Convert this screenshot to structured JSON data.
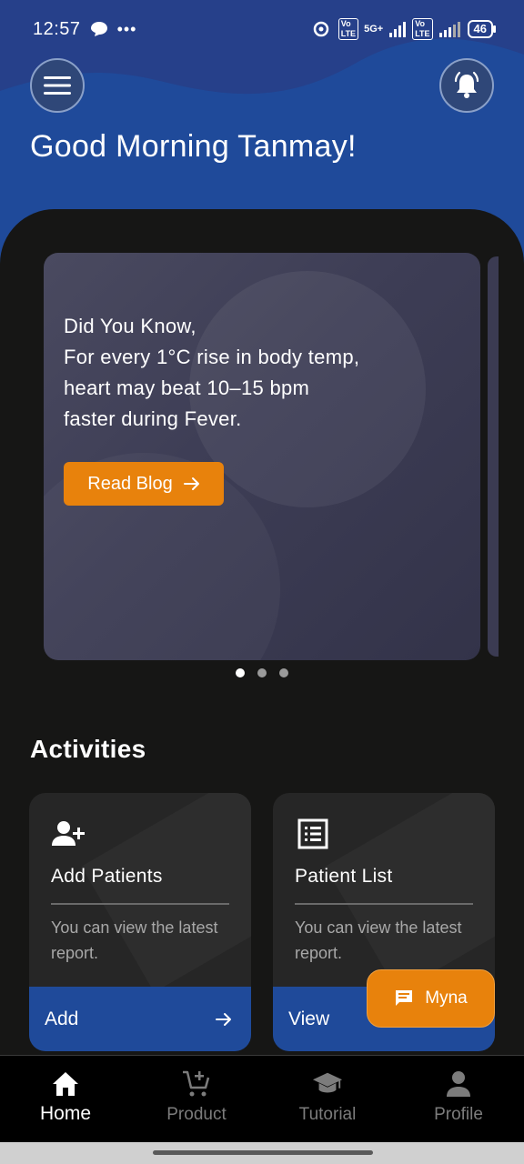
{
  "status_bar": {
    "time": "12:57",
    "network": "5G+",
    "lte_badge": "Vo LTE",
    "battery": "46"
  },
  "header": {
    "greeting": "Good Morning Tanmay!"
  },
  "carousel": {
    "lines": [
      "Did You Know,",
      "For every 1°C rise in body temp,",
      "heart may beat 10–15 bpm",
      "faster during Fever."
    ],
    "button_label": "Read Blog",
    "active_index": 0,
    "total": 3
  },
  "activities": {
    "title": "Activities",
    "cards": [
      {
        "title": "Add Patients",
        "description": "You can view the latest report.",
        "action": "Add"
      },
      {
        "title": "Patient List",
        "description": "You can view the latest report.",
        "action": "View"
      }
    ]
  },
  "chat_fab": {
    "label": "Myna"
  },
  "bottom_nav": {
    "items": [
      {
        "label": "Home",
        "icon": "home-icon",
        "active": true
      },
      {
        "label": "Product",
        "icon": "cart-icon",
        "active": false
      },
      {
        "label": "Tutorial",
        "icon": "graduation-cap-icon",
        "active": false
      },
      {
        "label": "Profile",
        "icon": "person-icon",
        "active": false
      }
    ]
  },
  "colors": {
    "brand_blue": "#1f4a9a",
    "accent_orange": "#e8820c",
    "background": "#161615"
  }
}
